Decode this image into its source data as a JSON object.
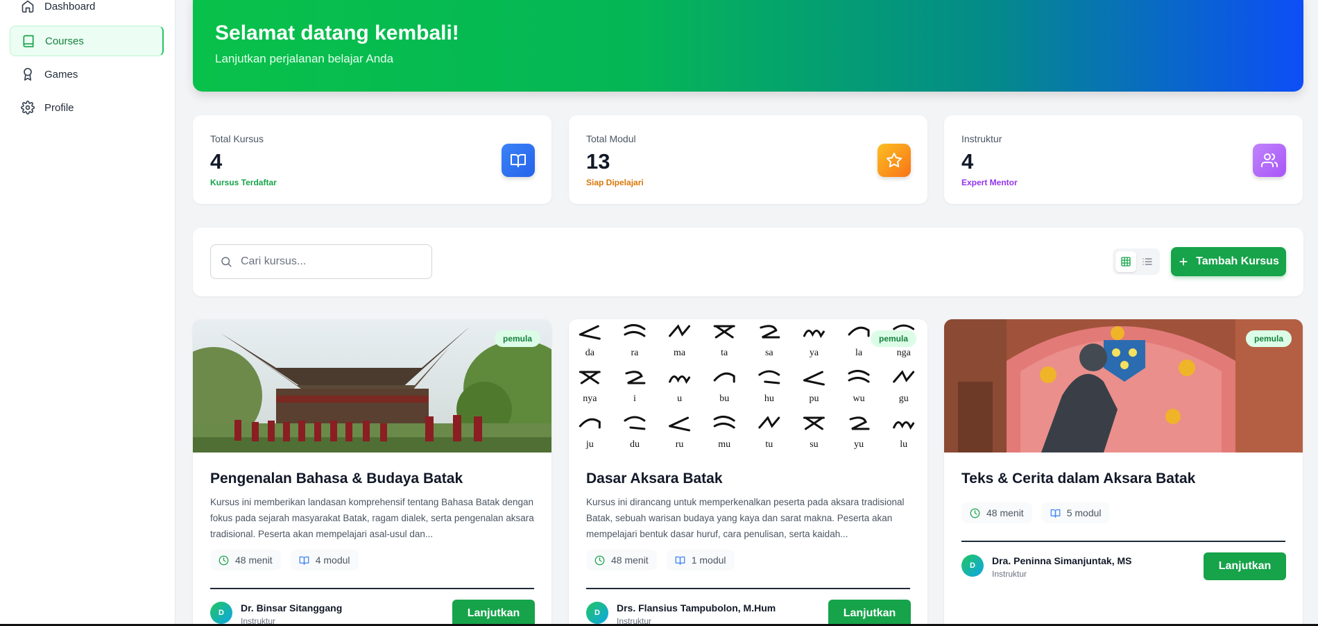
{
  "sidebar": {
    "items": [
      {
        "label": "Dashboard",
        "icon": "home-icon"
      },
      {
        "label": "Courses",
        "icon": "book-icon",
        "active": true
      },
      {
        "label": "Games",
        "icon": "award-icon"
      },
      {
        "label": "Profile",
        "icon": "gear-icon"
      }
    ]
  },
  "hero": {
    "title": "Selamat datang kembali!",
    "subtitle": "Lanjutkan perjalanan belajar Anda"
  },
  "stats": [
    {
      "label": "Total Kursus",
      "value": "4",
      "note": "Kursus Terdaftar",
      "note_color": "#16a34a",
      "icon": "book-open-icon",
      "icon_bg": "#3b82f6"
    },
    {
      "label": "Total Modul",
      "value": "13",
      "note": "Siap Dipelajari",
      "note_color": "#d97706",
      "icon": "star-icon",
      "icon_bg": "#f59e0b"
    },
    {
      "label": "Instruktur",
      "value": "4",
      "note": "Expert Mentor",
      "note_color": "#9333ea",
      "icon": "users-icon",
      "icon_bg": "#a855f7"
    }
  ],
  "toolbar": {
    "search_placeholder": "Cari kursus...",
    "add_label": "Tambah Kursus"
  },
  "courses": [
    {
      "level": "pemula",
      "title": "Pengenalan Bahasa & Budaya Batak",
      "description": "Kursus ini memberikan landasan komprehensif tentang Bahasa Batak dengan fokus pada sejarah masyarakat Batak, ragam dialek, serta pengenalan aksara tradisional. Peserta akan mempelajari asal-usul dan...",
      "duration": "48 menit",
      "modules": "4 modul",
      "instructor_initial": "D",
      "instructor": "Dr. Binsar Sitanggang",
      "instructor_role": "Instruktur",
      "action": "Lanjutkan"
    },
    {
      "level": "pemula",
      "title": "Dasar Aksara Batak",
      "description": "Kursus ini dirancang untuk memperkenalkan peserta pada aksara tradisional Batak, sebuah warisan budaya yang kaya dan sarat makna. Peserta akan mempelajari bentuk dasar huruf, cara penulisan, serta kaidah...",
      "duration": "48 menit",
      "modules": "1 modul",
      "instructor_initial": "D",
      "instructor": "Drs. Flansius Tampubolon, M.Hum",
      "instructor_role": "Instruktur",
      "action": "Lanjutkan",
      "aksara_rows": [
        [
          "da",
          "ra",
          "ma",
          "ta",
          "sa",
          "ya",
          "la",
          "nga"
        ],
        [
          "nya",
          "i",
          "u",
          "bu",
          "hu",
          "pu",
          "wu",
          "gu"
        ],
        [
          "ju",
          "du",
          "ru",
          "mu",
          "tu",
          "su",
          "yu",
          "lu"
        ]
      ]
    },
    {
      "level": "pemula",
      "title": "Teks & Cerita dalam Aksara Batak",
      "description": "",
      "duration": "48 menit",
      "modules": "5 modul",
      "instructor_initial": "D",
      "instructor": "Dra. Peninna Simanjuntak, MS",
      "instructor_role": "Instruktur",
      "action": "Lanjutkan"
    }
  ]
}
